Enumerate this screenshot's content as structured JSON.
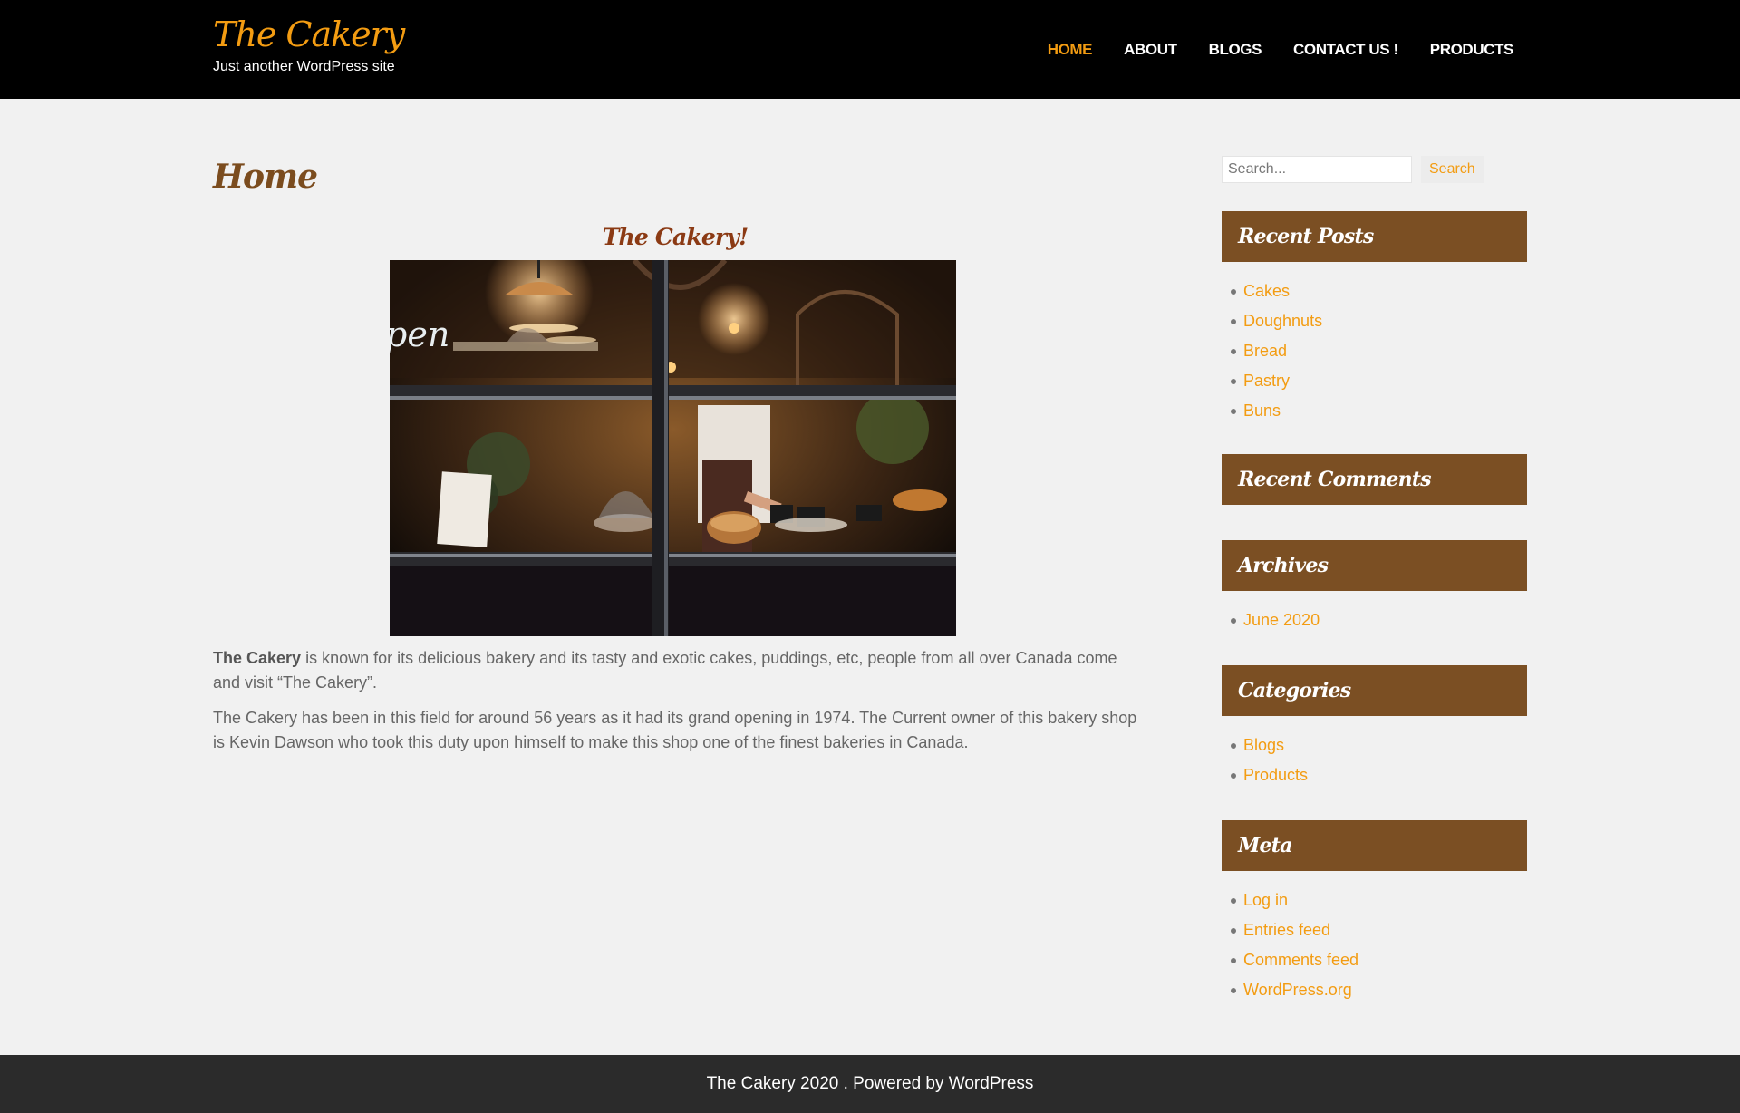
{
  "header": {
    "site_title": "The Cakery",
    "tagline": "Just another WordPress site",
    "nav": [
      {
        "label": "HOME"
      },
      {
        "label": "ABOUT"
      },
      {
        "label": "BLOGS"
      },
      {
        "label": "CONTACT US !"
      },
      {
        "label": "PRODUCTS"
      }
    ]
  },
  "main": {
    "page_title": "Home",
    "post_heading": "The Cakery!",
    "image_text": "pen",
    "paragraph1": {
      "bold": "The Cakery",
      "text": " is known for its delicious bakery and its tasty and exotic cakes, puddings, etc,  people from all over Canada come and visit “The Cakery”."
    },
    "paragraph2": "The Cakery has been in this field for around 56 years as it had its grand opening in 1974. The Current owner of this bakery shop is Kevin Dawson who took this duty upon himself to make this shop one of the finest bakeries in Canada."
  },
  "sidebar": {
    "search": {
      "placeholder": "Search...",
      "button": "Search"
    },
    "recent_posts": {
      "title": "Recent Posts",
      "items": [
        "Cakes",
        "Doughnuts",
        "Bread",
        "Pastry",
        "Buns"
      ]
    },
    "recent_comments": {
      "title": "Recent Comments"
    },
    "archives": {
      "title": "Archives",
      "items": [
        "June 2020"
      ]
    },
    "categories": {
      "title": "Categories",
      "items": [
        "Blogs",
        "Products"
      ]
    },
    "meta": {
      "title": "Meta",
      "items": [
        "Log in",
        "Entries feed",
        "Comments feed",
        "WordPress.org"
      ]
    }
  },
  "footer": {
    "text": "The Cakery 2020 . Powered by WordPress"
  },
  "colors": {
    "accent": "#f39c12",
    "widget_header": "#7b4f23",
    "header_bg": "#000000",
    "footer_bg": "#2b2b2b",
    "page_bg": "#f1f1f1"
  }
}
